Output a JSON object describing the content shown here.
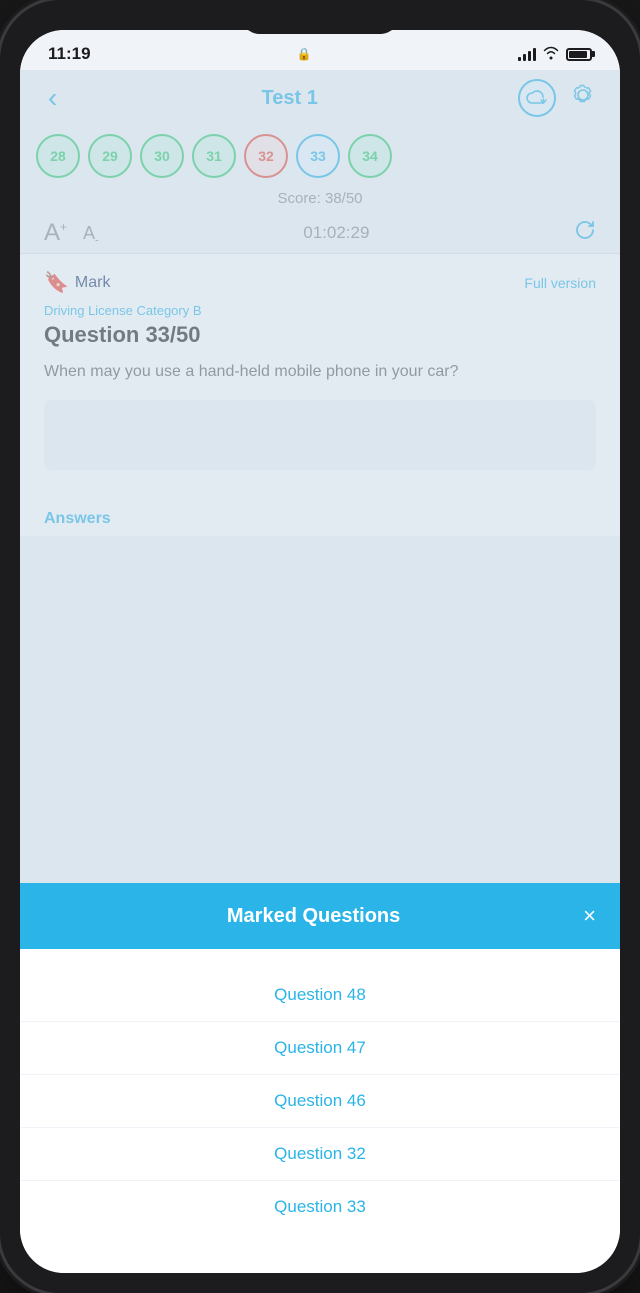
{
  "statusBar": {
    "time": "11:19",
    "lockIcon": "🔒"
  },
  "header": {
    "backLabel": "‹",
    "title": "Test 1",
    "cloudAlt": "cloud-sync",
    "settingsAlt": "settings"
  },
  "questionNav": {
    "bubbles": [
      {
        "number": "28",
        "state": "correct"
      },
      {
        "number": "29",
        "state": "correct"
      },
      {
        "number": "30",
        "state": "correct"
      },
      {
        "number": "31",
        "state": "correct"
      },
      {
        "number": "32",
        "state": "wrong"
      },
      {
        "number": "33",
        "state": "current"
      },
      {
        "number": "34",
        "state": "correct"
      }
    ]
  },
  "score": {
    "label": "Score: 38/50"
  },
  "fontControls": {
    "incLabel": "A",
    "decLabel": "A",
    "timer": "01:02:29"
  },
  "question": {
    "markLabel": "Mark",
    "fullVersionLabel": "Full version",
    "category": "Driving License Category B",
    "number": "Question 33/50",
    "text": "When may you use a hand-held mobile phone in your car?"
  },
  "answers": {
    "label": "Answers"
  },
  "modal": {
    "title": "Marked Questions",
    "closeLabel": "×",
    "items": [
      {
        "label": "Question 48"
      },
      {
        "label": "Question 47"
      },
      {
        "label": "Question 46"
      },
      {
        "label": "Question 32"
      },
      {
        "label": "Question 33"
      }
    ]
  }
}
